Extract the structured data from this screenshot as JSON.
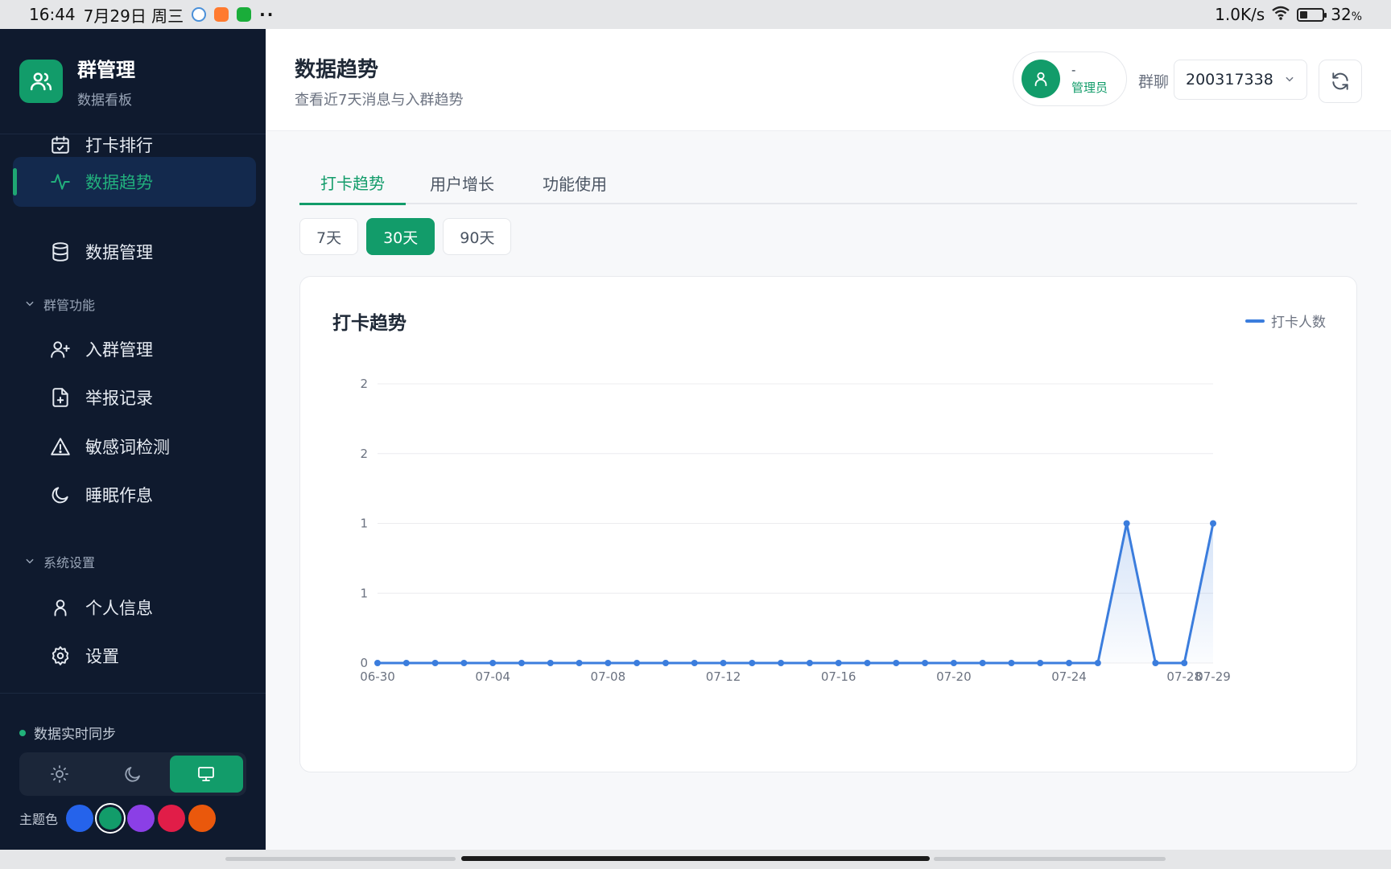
{
  "status_bar": {
    "time": "16:44",
    "date": "7月29日 周三",
    "more": "··",
    "net_speed": "1.0K/s",
    "battery": "32",
    "battery_unit": "%",
    "battery_level": 0.32
  },
  "sidebar": {
    "brand_title": "群管理",
    "brand_subtitle": "数据看板",
    "items": [
      {
        "label": "打卡排行",
        "icon": "calendar-check-icon"
      },
      {
        "label": "数据趋势",
        "icon": "activity-icon",
        "active": true
      },
      {
        "label": "数据管理",
        "icon": "database-icon"
      }
    ],
    "group_features": {
      "title": "群管功能",
      "items": [
        {
          "label": "入群管理",
          "icon": "user-plus-icon"
        },
        {
          "label": "举报记录",
          "icon": "file-plus-icon"
        },
        {
          "label": "敏感词检测",
          "icon": "alert-triangle-icon"
        },
        {
          "label": "睡眠作息",
          "icon": "moon-icon"
        }
      ]
    },
    "group_system": {
      "title": "系统设置",
      "items": [
        {
          "label": "个人信息",
          "icon": "user-icon"
        },
        {
          "label": "设置",
          "icon": "gear-icon"
        }
      ]
    },
    "sync_text": "数据实时同步",
    "theme_modes": [
      "light",
      "dark",
      "system"
    ],
    "theme_mode_active": "system",
    "theme_color_label": "主题色",
    "theme_colors": [
      "#2563eb",
      "#129c6a",
      "#8b3fe6",
      "#e11d48",
      "#ea580c"
    ],
    "theme_color_selected": "#129c6a"
  },
  "header": {
    "title": "数据趋势",
    "subtitle": "查看近7天消息与入群趋势",
    "user_name": "-",
    "user_role": "管理员",
    "group_label": "群聊",
    "group_id": "200317338"
  },
  "tabs": [
    {
      "label": "打卡趋势",
      "active": true
    },
    {
      "label": "用户增长"
    },
    {
      "label": "功能使用"
    }
  ],
  "ranges": [
    {
      "label": "7天"
    },
    {
      "label": "30天",
      "active": true
    },
    {
      "label": "90天"
    }
  ],
  "chart_card": {
    "title": "打卡趋势",
    "legend_label": "打卡人数"
  },
  "chart_data": {
    "type": "area",
    "title": "打卡趋势",
    "x": [
      "06-30",
      "07-01",
      "07-02",
      "07-03",
      "07-04",
      "07-05",
      "07-06",
      "07-07",
      "07-08",
      "07-09",
      "07-10",
      "07-11",
      "07-12",
      "07-13",
      "07-14",
      "07-15",
      "07-16",
      "07-17",
      "07-18",
      "07-19",
      "07-20",
      "07-21",
      "07-22",
      "07-23",
      "07-24",
      "07-25",
      "07-26",
      "07-27",
      "07-28",
      "07-29"
    ],
    "series": [
      {
        "name": "打卡人数",
        "color": "#3b7ddd",
        "values": [
          0,
          0,
          0,
          0,
          0,
          0,
          0,
          0,
          0,
          0,
          0,
          0,
          0,
          0,
          0,
          0,
          0,
          0,
          0,
          0,
          0,
          0,
          0,
          0,
          0,
          0,
          1,
          0,
          0,
          1
        ]
      }
    ],
    "x_tick_labels": [
      "06-30",
      "07-04",
      "07-08",
      "07-12",
      "07-16",
      "07-20",
      "07-24",
      "07-28",
      "07-29"
    ],
    "y_tick_labels": [
      "0",
      "1",
      "1",
      "2",
      "2"
    ],
    "ylim": [
      0,
      2
    ],
    "grid": true,
    "legend": "top-right"
  }
}
